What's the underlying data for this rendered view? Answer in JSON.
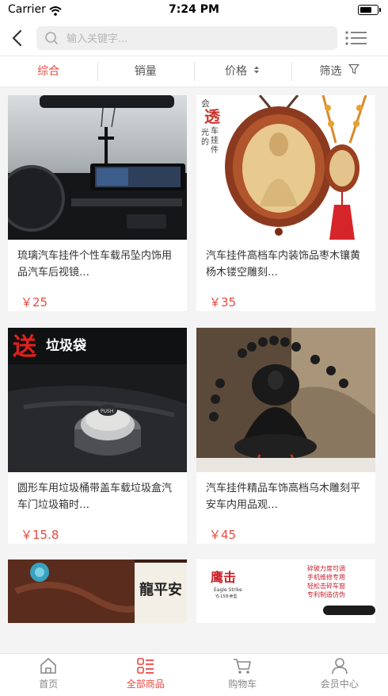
{
  "status_bar": {
    "carrier": "Carrier",
    "time": "7:24 PM"
  },
  "search": {
    "placeholder": "输入关键字..."
  },
  "sort_tabs": [
    {
      "label": "综合",
      "active": true
    },
    {
      "label": "销量",
      "active": false
    },
    {
      "label": "价格",
      "active": false,
      "icon": "sort-arrows-icon"
    },
    {
      "label": "筛选",
      "active": false,
      "icon": "filter-icon"
    }
  ],
  "products": [
    {
      "name": "琉璃汽车挂件个性车载吊坠内饰用品汽车后视镜…",
      "price": "￥25"
    },
    {
      "name": "汽车挂件高档车内装饰品枣木镶黄杨木镂空雕刻…",
      "price": "￥35",
      "image_text": "会\n透\n光\n的\n车\n挂\n件"
    },
    {
      "name": "圆形车用垃圾桶带盖车载垃圾盒汽车门垃圾箱时…",
      "price": "￥15.8",
      "image_text": [
        "送",
        "垃圾袋",
        "PUSH"
      ]
    },
    {
      "name": "汽车挂件精品车饰高档乌木雕刻平安车内用品观…",
      "price": "￥45"
    },
    {
      "name": "",
      "price": "",
      "image_text": [
        "龍平安"
      ]
    },
    {
      "name": "",
      "price": "",
      "image_text": [
        "鹰击",
        "Eagle Strike",
        "YJ-15外卖型",
        "碎玻力度可调",
        "手机维修专用",
        "轻松击碎车窗",
        "专利制造仿伪"
      ]
    }
  ],
  "tab_bar": [
    {
      "label": "首页",
      "icon": "home-icon",
      "active": false
    },
    {
      "label": "全部商品",
      "icon": "category-list-icon",
      "active": true
    },
    {
      "label": "购物车",
      "icon": "cart-icon",
      "active": false
    },
    {
      "label": "会员中心",
      "icon": "user-icon",
      "active": false
    }
  ],
  "colors": {
    "accent": "#e9483f",
    "page_bg": "#f4f4f4"
  }
}
